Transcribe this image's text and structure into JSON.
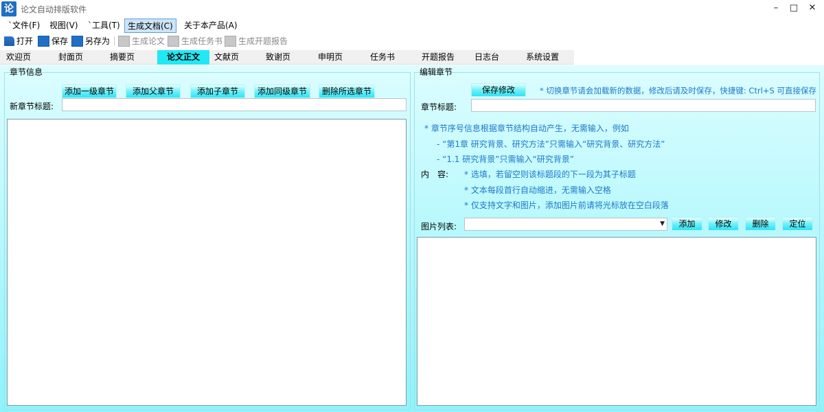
{
  "window": {
    "title": "论文自动排版软件",
    "icon_glyph": "论",
    "minimize": "–",
    "maximize": "□",
    "close": "✕"
  },
  "menu": [
    "`文件(F)",
    "视图(V)",
    "`工具(T)",
    "生成文档(C)",
    "关于本产品(A)"
  ],
  "menu_active_index": 3,
  "toolbar": {
    "open": "打开",
    "save": "保存",
    "save_as": "另存为",
    "gen_paper": "生成论文",
    "gen_task": "生成任务书",
    "gen_proposal": "生成开题报告"
  },
  "tabs": [
    "欢迎页",
    "封面页",
    "摘要页",
    "论文正文",
    "文献页",
    "致谢页",
    "申明页",
    "任务书",
    "开题报告",
    "日志台",
    "系统设置"
  ],
  "active_tab": "论文正文",
  "left_panel": {
    "title": "章节信息",
    "buttons": [
      "添加一级章节",
      "添加父章节",
      "添加子章节",
      "添加同级章节",
      "删除所选章节"
    ],
    "new_title_label": "新章节标题:",
    "new_title_value": ""
  },
  "right_panel": {
    "title": "编辑章节",
    "save_button": "保存修改",
    "save_tip": "* 切换章节请会加载新的数据，修改后请及时保存，快捷键: Ctrl+S 可直接保存",
    "chapter_title_label": "章节标题:",
    "chapter_title_value": "",
    "hint1": "* 章节序号信息根据章节结构自动产生，无需输入，例如",
    "hint2": "- “第1章 研究背景、研究方法”只需输入“研究背景、研究方法”",
    "hint3": "- “1.1 研究背景”只需输入“研究背景”",
    "content_label": "内　容:",
    "content_hint1": "* 选填，若留空则该标题段的下一段为其子标题",
    "content_hint2": "* 文本每段首行自动缩进，无需输入空格",
    "content_hint3": "* 仅支持文字和图片，添加图片前请将光标放在空白段落",
    "image_list_label": "图片列表:",
    "image_list_value": "",
    "image_buttons": [
      "添加",
      "修改",
      "删除",
      "定位"
    ]
  }
}
